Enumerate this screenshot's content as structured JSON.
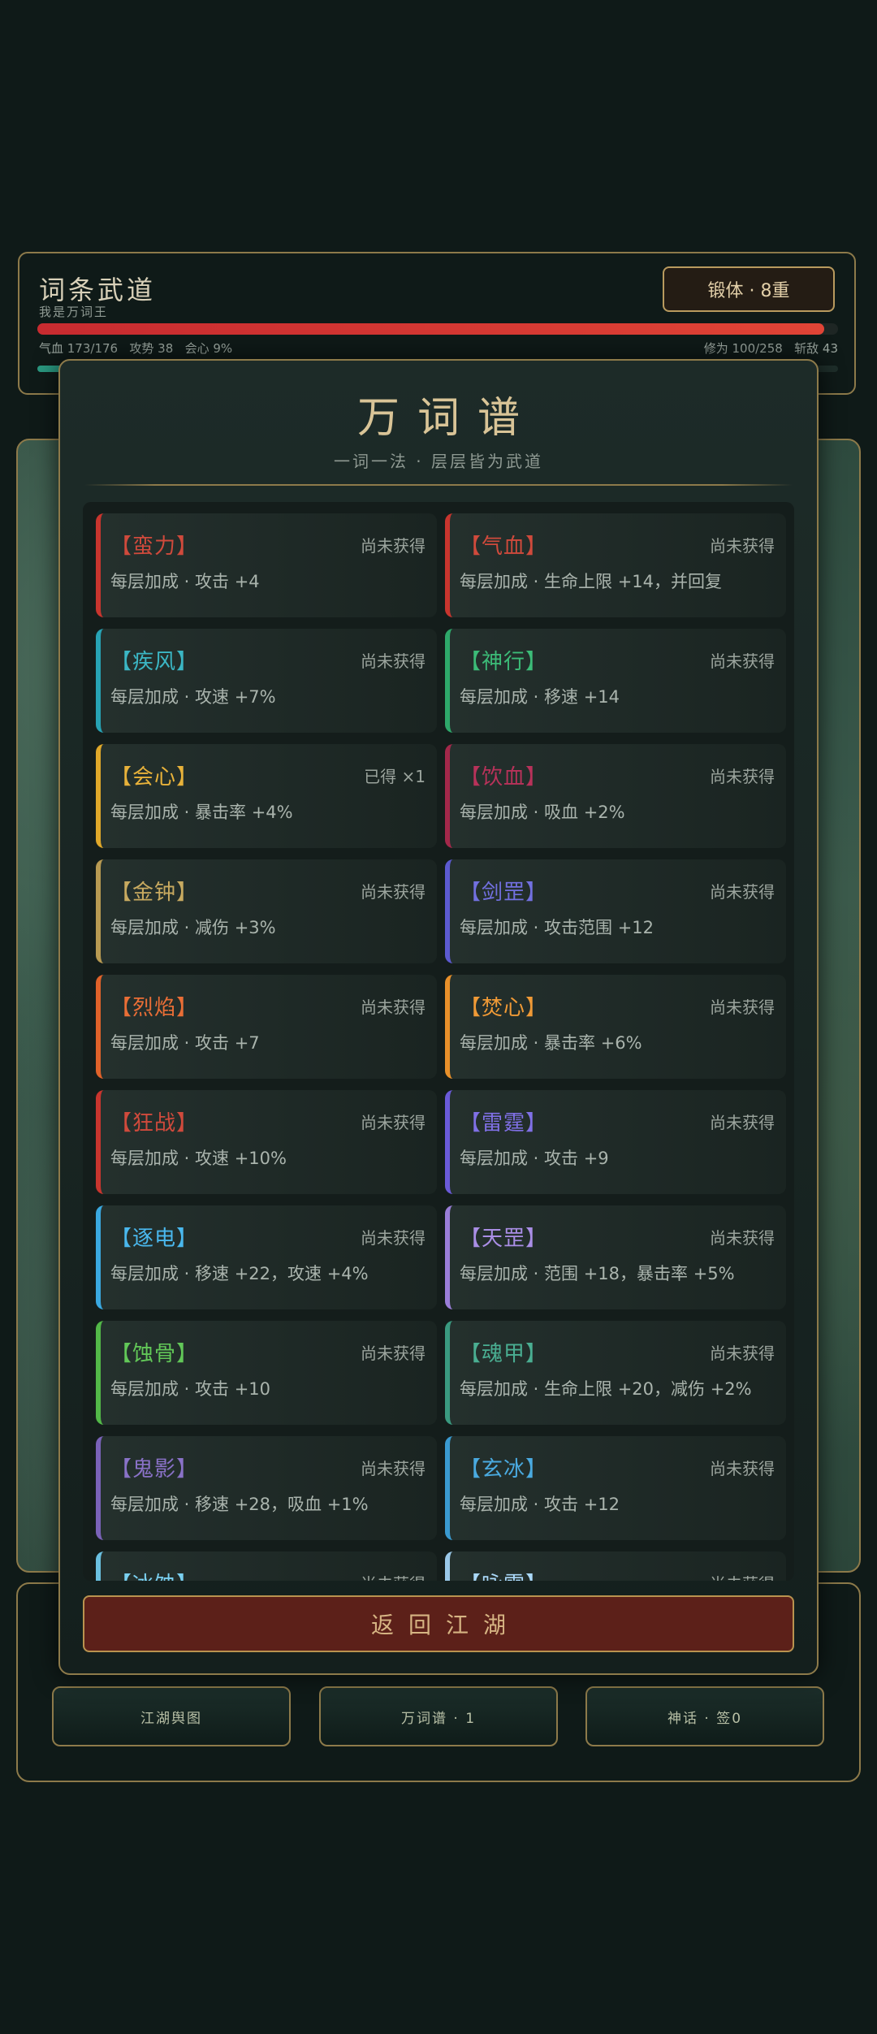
{
  "header": {
    "title": "词条武道",
    "subtitle": "我是万词王",
    "realm_badge": "锻体 · 8重",
    "hp_label": "气血 173/176",
    "hp_fraction": 0.983,
    "attack_label": "攻势 38",
    "crit_label": "会心 9%",
    "cultivation_label": "修为 100/258",
    "cultivation_fraction": 0.39,
    "kills_label": "斩敌 43"
  },
  "modal": {
    "title": "万词谱",
    "subtitle": "一词一法 · 层层皆为武道",
    "return_button": "返回江湖"
  },
  "entries": [
    {
      "name": "【蛮力】",
      "status": "尚未获得",
      "effect": "每层加成 · 攻击 +4",
      "color": "#c8352e",
      "name_color": "#d04a3c"
    },
    {
      "name": "【气血】",
      "status": "尚未获得",
      "effect": "每层加成 · 生命上限 +14，并回复",
      "color": "#c8352e",
      "name_color": "#d04a3c"
    },
    {
      "name": "【疾风】",
      "status": "尚未获得",
      "effect": "每层加成 · 攻速 +7%",
      "color": "#27a2b4",
      "name_color": "#3bb6c4"
    },
    {
      "name": "【神行】",
      "status": "尚未获得",
      "effect": "每层加成 · 移速 +14",
      "color": "#2ea86a",
      "name_color": "#3cbc78"
    },
    {
      "name": "【会心】",
      "status": "已得 ×1",
      "effect": "每层加成 · 暴击率 +4%",
      "color": "#e0a82a",
      "name_color": "#e8b23a"
    },
    {
      "name": "【饮血】",
      "status": "尚未获得",
      "effect": "每层加成 · 吸血 +2%",
      "color": "#a3284a",
      "name_color": "#b8325a"
    },
    {
      "name": "【金钟】",
      "status": "尚未获得",
      "effect": "每层加成 · 减伤 +3%",
      "color": "#b89a52",
      "name_color": "#c8aa60"
    },
    {
      "name": "【剑罡】",
      "status": "尚未获得",
      "effect": "每层加成 · 攻击范围 +12",
      "color": "#5c5ad0",
      "name_color": "#7270e0"
    },
    {
      "name": "【烈焰】",
      "status": "尚未获得",
      "effect": "每层加成 · 攻击 +7",
      "color": "#e0622a",
      "name_color": "#ea6e36"
    },
    {
      "name": "【焚心】",
      "status": "尚未获得",
      "effect": "每层加成 · 暴击率 +6%",
      "color": "#e8902a",
      "name_color": "#f09a36"
    },
    {
      "name": "【狂战】",
      "status": "尚未获得",
      "effect": "每层加成 · 攻速 +10%",
      "color": "#c8352e",
      "name_color": "#d04a3c"
    },
    {
      "name": "【雷霆】",
      "status": "尚未获得",
      "effect": "每层加成 · 攻击 +9",
      "color": "#6a5ad8",
      "name_color": "#8070e6"
    },
    {
      "name": "【逐电】",
      "status": "尚未获得",
      "effect": "每层加成 · 移速 +22，攻速 +4%",
      "color": "#3aa8e0",
      "name_color": "#4ab8ee"
    },
    {
      "name": "【天罡】",
      "status": "尚未获得",
      "effect": "每层加成 · 范围 +18，暴击率 +5%",
      "color": "#9a7ed8",
      "name_color": "#aa8ee6"
    },
    {
      "name": "【蚀骨】",
      "status": "尚未获得",
      "effect": "每层加成 · 攻击 +10",
      "color": "#52b848",
      "name_color": "#62c858"
    },
    {
      "name": "【魂甲】",
      "status": "尚未获得",
      "effect": "每层加成 · 生命上限 +20，减伤 +2%",
      "color": "#3a9a80",
      "name_color": "#4aae92"
    },
    {
      "name": "【鬼影】",
      "status": "尚未获得",
      "effect": "每层加成 · 移速 +28，吸血 +1%",
      "color": "#7a62b8",
      "name_color": "#8a72c8"
    },
    {
      "name": "【玄冰】",
      "status": "尚未获得",
      "effect": "每层加成 · 攻击 +12",
      "color": "#3a9ad0",
      "name_color": "#4aaae0"
    },
    {
      "name": "【冰蚀】",
      "status": "尚未获得",
      "effect": "",
      "color": "#6ac0e0",
      "name_color": "#7ad0f0"
    },
    {
      "name": "【咏雪】",
      "status": "尚未获得",
      "effect": "",
      "color": "#9ac8e8",
      "name_color": "#aad8f8"
    }
  ],
  "bottom_nav": [
    {
      "label": "江湖舆图"
    },
    {
      "label": "万词谱 · 1"
    },
    {
      "label": "神话 · 签0"
    }
  ]
}
